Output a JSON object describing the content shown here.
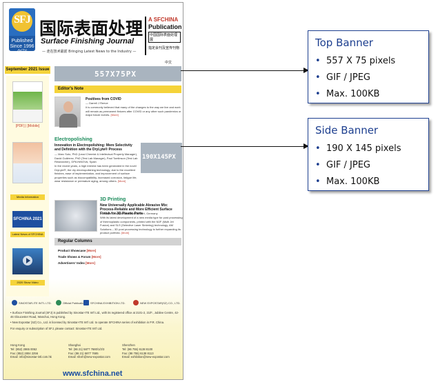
{
  "masthead": {
    "logo_text": "SFJ",
    "logo_sub": "Published Since 1996 创刊",
    "title_cn": "国际表面处理",
    "title_en": "Surface Finishing Journal",
    "tagline": "— 走在技术最前 Bringing Latest News to the Industry —",
    "pub_line1": "A SFCHINA",
    "pub_line2": "Publication",
    "pub_line3": "中国国际表面处理展",
    "pub_line4": "指定会刊及宣传刊物"
  },
  "lang_link": "中文",
  "issue": "September 2021 Issue",
  "left_col": {
    "thumb1_caption": "[PDF] | [Mobile]",
    "btn1": "Media Information",
    "btn2": "Latest News of SFCHINA",
    "btn3": "2020 Show Video",
    "sfchina_badge": "SFCHINA 2021"
  },
  "top_banner_label": "557X75PX",
  "editors_note": {
    "header": "Editor's Note",
    "title": "Positives from COVID",
    "author": "— Darrell J Reeve",
    "text": "It is commonly believed that many of the changes to the way we live and work will remain as permanent fixtures after COVID or any other such pandemics or major future events.",
    "more": "[More]"
  },
  "electroplating": {
    "category": "Electropolishing",
    "title": "Innovation in Electropolishing: More Selectivity and Definition with the DryLyte® Process",
    "author": "— Marc Soto, PhD (Lead Chemist & Intellectual Property Manager), David Gutiérrez, PhD (Test Lab Manager), Paul Tomlinson (Test Lab Researcher), GPA INNOVA, Spain",
    "text": "In the recent years, a high interest has been generated in the novel DryLyte®, the dry electropolishing technology, due to the excellent finishes, ease of implementation, and improvement of surface properties such as biocompatibility, increased corrosion, fatigue life, wear resistance or premature aging, among others.",
    "more": "[More]"
  },
  "side_banner_label": "190X145PX",
  "printing": {
    "category": "3D Printing",
    "title": "New Universally Applicable Abrasive Mix: Process-Reliable and More Efficient Surface Finish for 3D Plastic Parts",
    "author": "— Rösler Oberflächentechnik GmbH, Germany",
    "text": "With its latest development of a new media type for post processing of thermoplastic components, printed with the MJF (Multi Jet Fusion) and SLS (Selective Laser Sintering) technology, AM Solutions – 3D post processing technology is further expanding its product portfolio.",
    "more": "[More]"
  },
  "regular": {
    "header": "Regular Columns",
    "items": [
      {
        "label": "Product Showcase",
        "more": "[More]"
      },
      {
        "label": "Trade Shows & Forum",
        "more": "[More]"
      },
      {
        "label": "Advertisers' Index",
        "more": "[More]"
      }
    ]
  },
  "partners": [
    {
      "name": "SINOSTAR-ITE INT'L LTD."
    },
    {
      "name": "Official Publication"
    },
    {
      "name": "SFCHINA EXHIBITION LTD."
    },
    {
      "name": "NEW EXPOSTAR(SZ) CO., LTD."
    }
  ],
  "footnotes": [
    "Surface Finishing Journal (SFJ) is published by Sinostar-ITE Int'l Ltd., with its registered office at 2101-2, 21/F., Jubilee Centre, 42-46 Gloucester Road, Wanchai, Hong Kong.",
    "New Expostar (SZ) Co., Ltd. is licensed by Sinostar-ITE Int'l Ltd. to operate SFCHINA series of exhibition in P.R. China.",
    "For enquiry or subscription of SFJ, please contact: Sinostar-ITE Int'l Ltd."
  ],
  "contacts": [
    {
      "city": "Hong Kong",
      "tel": "Tel: (852) 2865 0062",
      "fax": "Fax: (852) 2804 2256",
      "email": "Email: info@sinostar-intl.com.hk"
    },
    {
      "city": "Shanghai",
      "tel": "Tel: (86 21) 5877 7680/1/2/3",
      "fax": "Fax: (86 21) 5877 7685",
      "email": "Email: sfcsh@new-expostar.com"
    },
    {
      "city": "Shenzhen",
      "tel": "Tel: (86 755) 6138 8100",
      "fax": "Fax: (86 755) 6138 8113",
      "email": "Email: exhibition@new-expostar.com"
    }
  ],
  "site_url": "www.sfchina.net",
  "top_spec": {
    "title": "Top Banner",
    "items": [
      "557 X 75 pixels",
      "GIF / JPEG",
      "Max. 100KB"
    ]
  },
  "side_spec": {
    "title": "Side Banner",
    "items": [
      "190 X 145 pixels",
      "GIF / JPEG",
      "Max. 100KB"
    ]
  },
  "colors": {
    "accent_yellow": "#f5d33a",
    "placeholder_gray": "#a9b4bf",
    "spec_blue": "#1d3f8f",
    "more_red": "#c0392b"
  }
}
